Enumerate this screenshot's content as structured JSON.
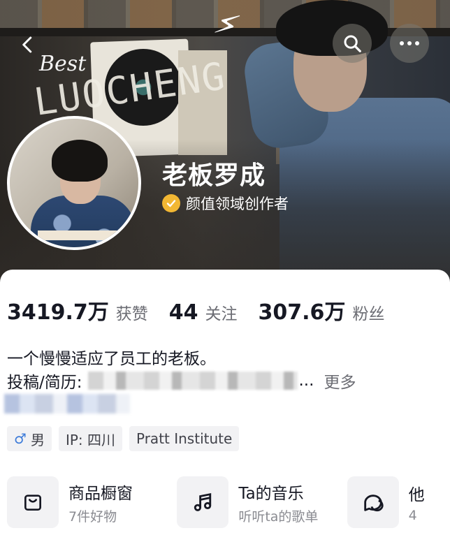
{
  "header": {
    "banner_text_1": "Best",
    "banner_text_2": "LUOCHENG",
    "back_icon": "chevron-left-icon",
    "search_icon": "search-icon",
    "more_icon": "more-dots-icon"
  },
  "profile": {
    "name": "老板罗成",
    "certification": "颜值领域创作者",
    "certification_color": "#f2b733"
  },
  "stats": [
    {
      "value": "3419.7万",
      "label": "获赞"
    },
    {
      "value": "44",
      "label": "关注"
    },
    {
      "value": "307.6万",
      "label": "粉丝"
    }
  ],
  "bio": {
    "line1": "一个慢慢适应了员工的老板。",
    "contact_prefix": "投稿/简历:",
    "ellipsis": "...",
    "more": "更多"
  },
  "tags": [
    {
      "icon": "male-icon",
      "label": "男"
    },
    {
      "label": "IP: 四川"
    },
    {
      "label": "Pratt Institute"
    }
  ],
  "services": [
    {
      "icon": "shopping-bag-icon",
      "title": "商品橱窗",
      "subtitle": "7件好物"
    },
    {
      "icon": "music-note-icon",
      "title": "Ta的音乐",
      "subtitle": "听听ta的歌单"
    },
    {
      "icon": "chat-bubbles-icon",
      "title": "他",
      "subtitle": "4"
    }
  ]
}
